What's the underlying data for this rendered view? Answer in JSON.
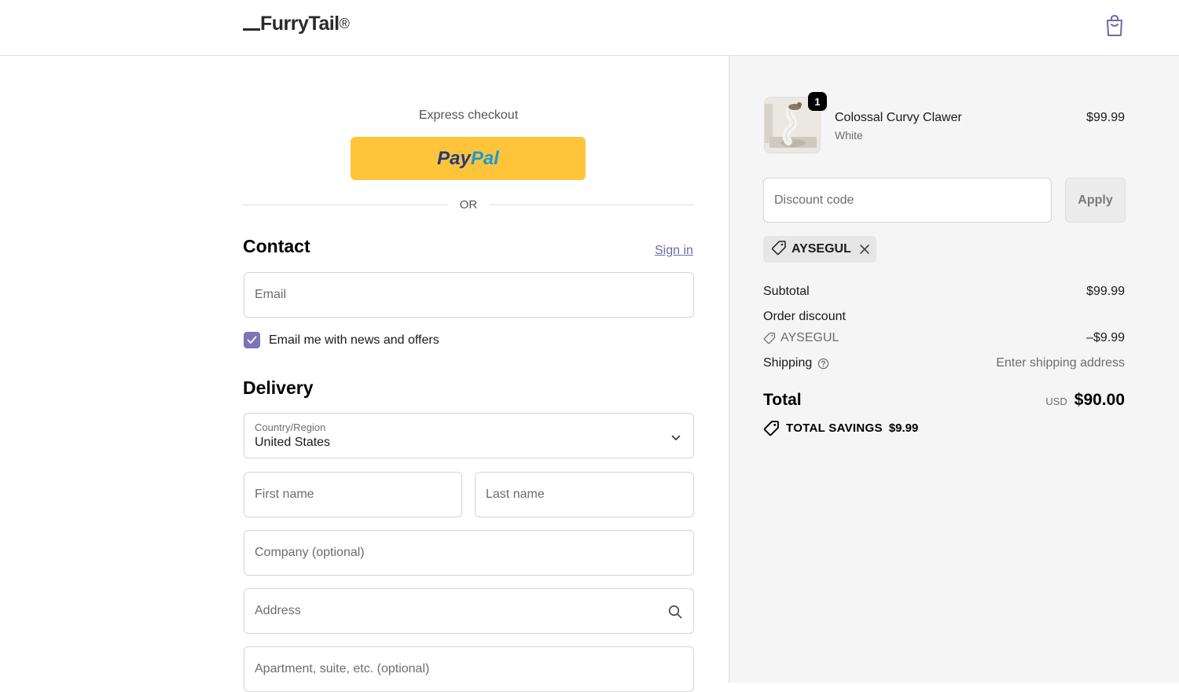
{
  "header": {
    "brand": "FurryTail",
    "brand_mark": "®",
    "cart_icon": "shopping-bag-icon"
  },
  "express": {
    "label": "Express checkout",
    "paypal_part1": "Pay",
    "paypal_part2": "Pal",
    "or": "OR"
  },
  "contact": {
    "title": "Contact",
    "sign_in": "Sign in",
    "email_placeholder": "Email",
    "newsletter_label": "Email me with news and offers",
    "newsletter_checked": true
  },
  "delivery": {
    "title": "Delivery",
    "country_label": "Country/Region",
    "country_value": "United States",
    "first_name_placeholder": "First name",
    "last_name_placeholder": "Last name",
    "company_placeholder": "Company (optional)",
    "address_placeholder": "Address",
    "apartment_placeholder": "Apartment, suite, etc. (optional)"
  },
  "summary": {
    "item": {
      "name": "Colossal Curvy Clawer",
      "variant": "White",
      "price": "$99.99",
      "quantity": "1"
    },
    "discount_placeholder": "Discount code",
    "apply_label": "Apply",
    "applied_code": "AYSEGUL",
    "subtotal_label": "Subtotal",
    "subtotal_value": "$99.99",
    "order_discount_label": "Order discount",
    "discount_code": "AYSEGUL",
    "discount_value": "–$9.99",
    "shipping_label": "Shipping",
    "shipping_value": "Enter shipping address",
    "total_label": "Total",
    "currency": "USD",
    "total_value": "$90.00",
    "savings_label": "TOTAL SAVINGS",
    "savings_value": "$9.99"
  },
  "colors": {
    "paypal_yellow": "#ffc439",
    "accent_purple": "#7b76b5",
    "link": "#6b6aa8"
  }
}
